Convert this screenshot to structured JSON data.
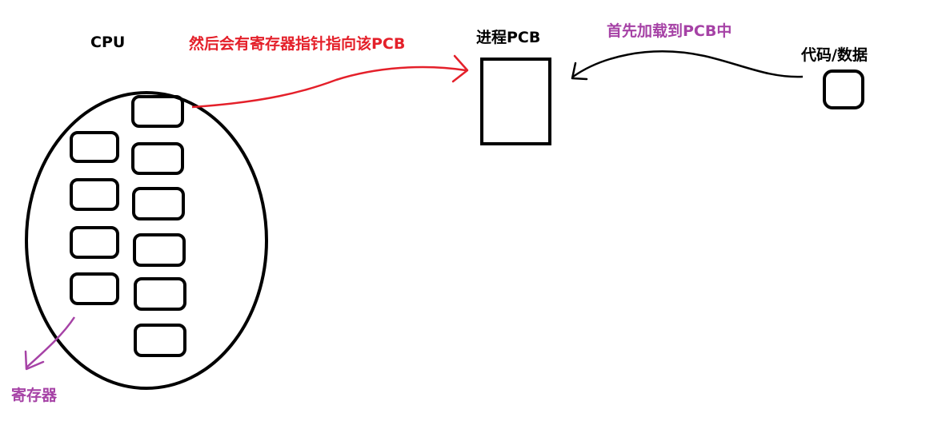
{
  "labels": {
    "cpu": "CPU",
    "registers": "寄存器",
    "pointer_note": "然后会有寄存器指针指向该PCB",
    "pcb": "进程PCB",
    "load_note": "首先加载到PCB中",
    "code_data": "代码/数据"
  },
  "colors": {
    "ink": "#000000",
    "red": "#e4202a",
    "purple": "#a642a6"
  }
}
